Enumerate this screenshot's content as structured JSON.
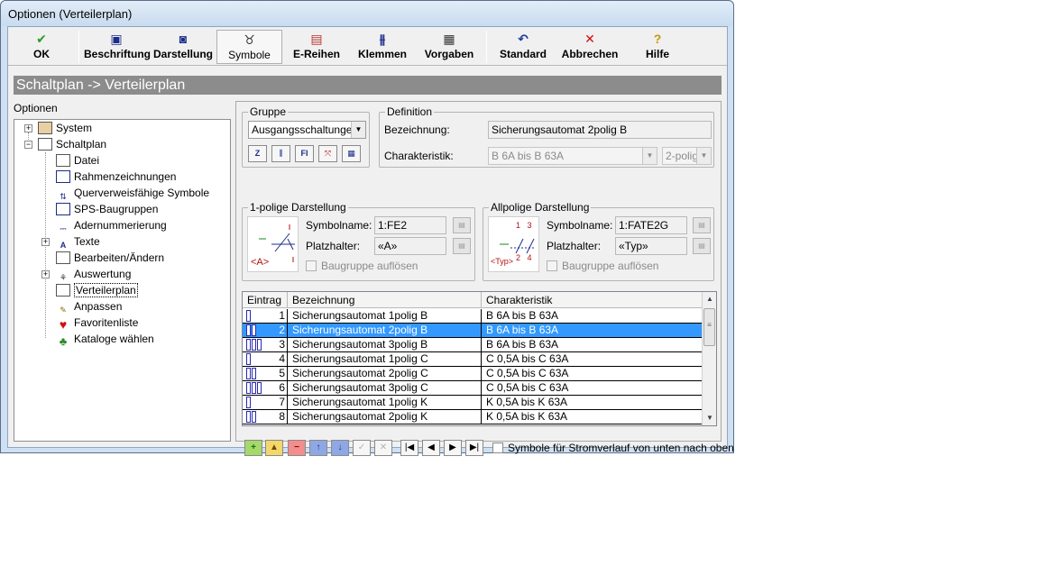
{
  "window": {
    "title": "Optionen (Verteilerplan)"
  },
  "toolbar": {
    "ok": "OK",
    "beschriftung": "Beschriftung",
    "darstellung": "Darstellung",
    "symbole": "Symbole",
    "ereihen": "E-Reihen",
    "klemmen": "Klemmen",
    "vorgaben": "Vorgaben",
    "standard": "Standard",
    "abbrechen": "Abbrechen",
    "hilfe": "Hilfe"
  },
  "heading": "Schaltplan -> Verteilerplan",
  "tree": {
    "label": "Optionen",
    "items": [
      "System",
      "Schaltplan",
      "Datei",
      "Rahmenzeichnungen",
      "Querverweisfähige Symbole",
      "SPS-Baugruppen",
      "Adernummerierung",
      "Texte",
      "Bearbeiten/Ändern",
      "Auswertung",
      "Verteilerplan",
      "Anpassen",
      "Favoritenliste",
      "Kataloge wählen"
    ],
    "selected": "Verteilerplan"
  },
  "gruppe": {
    "legend": "Gruppe",
    "value": "Ausgangsschaltungen",
    "icons": [
      "Z",
      "FI"
    ]
  },
  "definition": {
    "legend": "Definition",
    "bezeichnung_label": "Bezeichnung:",
    "bezeichnung_value": "Sicherungsautomat 2polig B",
    "charakteristik_label": "Charakteristik:",
    "charakteristik_value": "B 6A  bis  B 63A",
    "poles_value": "2-polig"
  },
  "einpolig": {
    "legend": "1-polige Darstellung",
    "symbolname_label": "Symbolname:",
    "symbolname_value": "1:FE2",
    "platzhalter_label": "Platzhalter:",
    "platzhalter_value": "«A»",
    "preview_text": "<A>",
    "checkbox_label": "Baugruppe auflösen"
  },
  "allpolig": {
    "legend": "Allpolige Darstellung",
    "symbolname_label": "Symbolname:",
    "symbolname_value": "1:FATE2G",
    "platzhalter_label": "Platzhalter:",
    "platzhalter_value": "«Typ»",
    "preview_text": "<Typ>",
    "preview_pins_top": "1   3",
    "preview_pins_bottom": "2   4",
    "checkbox_label": "Baugruppe auflösen"
  },
  "table": {
    "headers": [
      "Eintrag",
      "Bezeichnung",
      "Charakteristik"
    ],
    "rows": [
      {
        "num": "1",
        "bez": "Sicherungsautomat 1polig B",
        "char": "B 6A  bis  B 63A"
      },
      {
        "num": "2",
        "bez": "Sicherungsautomat 2polig B",
        "char": "B 6A  bis  B 63A"
      },
      {
        "num": "3",
        "bez": "Sicherungsautomat 3polig B",
        "char": "B 6A  bis  B 63A"
      },
      {
        "num": "4",
        "bez": "Sicherungsautomat 1polig C",
        "char": "C 0,5A  bis  C 63A"
      },
      {
        "num": "5",
        "bez": "Sicherungsautomat 2polig C",
        "char": "C 0,5A  bis  C 63A"
      },
      {
        "num": "6",
        "bez": "Sicherungsautomat 3polig C",
        "char": "C 0,5A  bis  C 63A"
      },
      {
        "num": "7",
        "bez": "Sicherungsautomat 1polig K",
        "char": "K 0,5A  bis  K 63A"
      },
      {
        "num": "8",
        "bez": "Sicherungsautomat 2polig K",
        "char": "K 0,5A  bis  K 63A"
      }
    ],
    "selected_row": 2
  },
  "bottom": {
    "checkbox_label": "Symbole für Stromverlauf von unten nach oben"
  }
}
